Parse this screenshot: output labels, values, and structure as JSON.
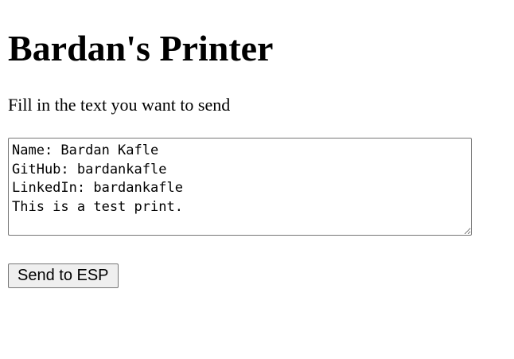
{
  "page": {
    "title": "Bardan's Printer",
    "prompt": "Fill in the text you want to send"
  },
  "form": {
    "message_value": "Name: Bardan Kafle\nGitHub: bardankafle\nLinkedIn: bardankafle\nThis is a test print.",
    "send_label": "Send to ESP"
  }
}
